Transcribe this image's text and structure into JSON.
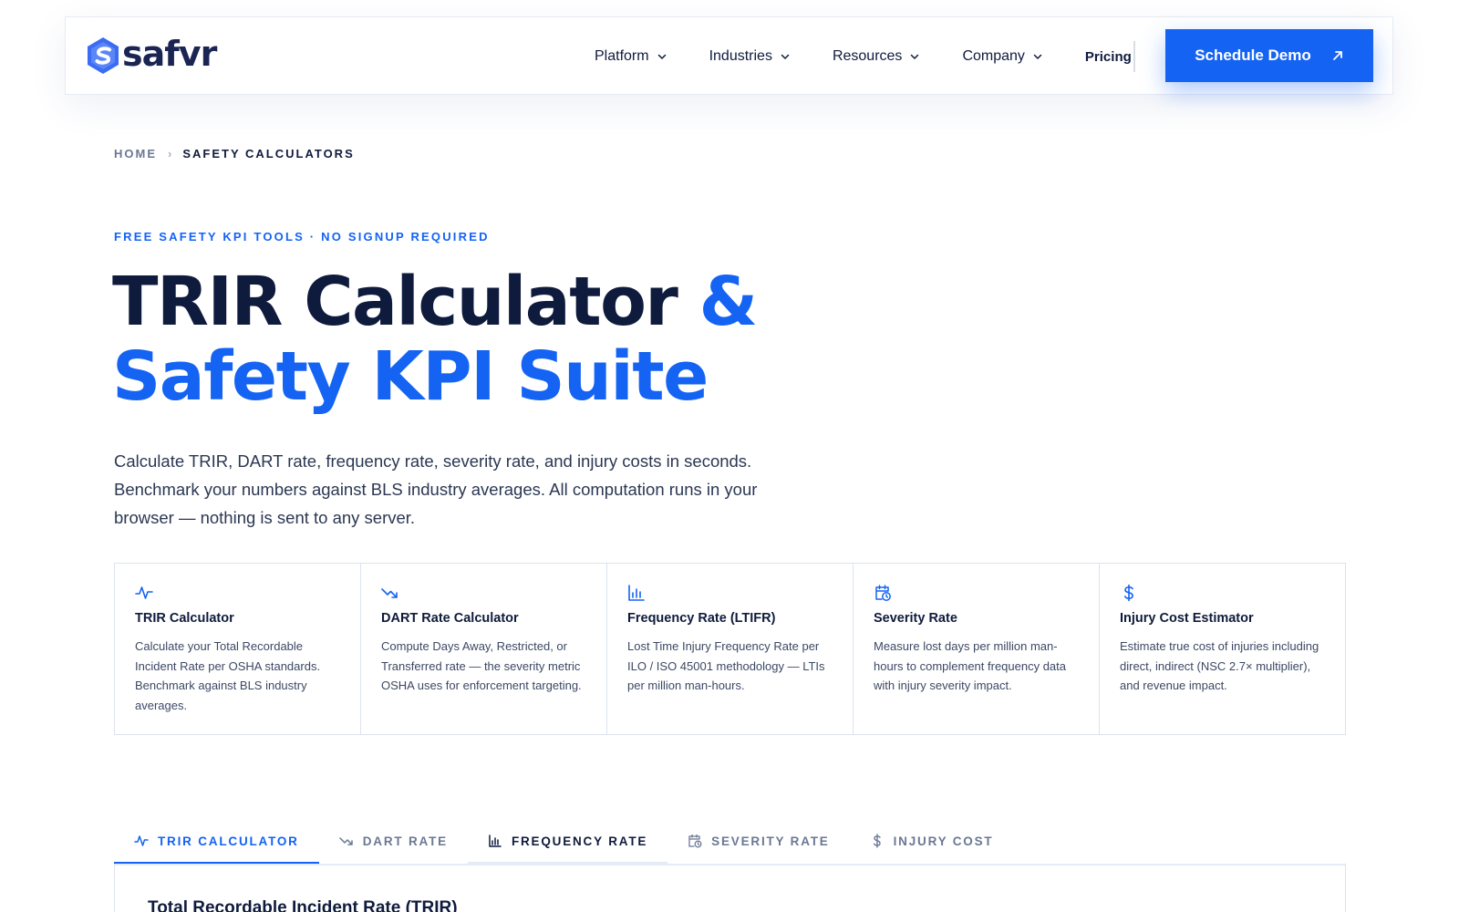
{
  "brand": {
    "name": "safvr",
    "accent": "#1463f3",
    "text": "#0f1b3d"
  },
  "nav": {
    "items": [
      {
        "label": "Platform",
        "icon": "chevron-down-icon"
      },
      {
        "label": "Industries",
        "icon": "chevron-down-icon"
      },
      {
        "label": "Resources",
        "icon": "chevron-down-icon"
      },
      {
        "label": "Company",
        "icon": "chevron-down-icon"
      }
    ],
    "pricing": "Pricing",
    "cta": {
      "label": "Schedule Demo",
      "icon": "arrow-up-right-icon"
    }
  },
  "breadcrumb": {
    "home": "HOME",
    "separator": "›",
    "current": "SAFETY CALCULATORS"
  },
  "hero": {
    "eyebrow": "FREE SAFETY KPI TOOLS · NO SIGNUP REQUIRED",
    "title_part1": "TRIR Calculator ",
    "title_part2": "&",
    "title_line2": "Safety KPI Suite",
    "description": "Calculate TRIR, DART rate, frequency rate, severity rate, and injury costs in seconds. Benchmark your numbers against BLS industry averages. All computation runs in your browser — nothing is sent to any server."
  },
  "cards": [
    {
      "icon": "activity-pulse-icon",
      "title": "TRIR Calculator",
      "description": "Calculate your Total Recordable Incident Rate per OSHA standards. Benchmark against BLS industry averages."
    },
    {
      "icon": "trending-down-icon",
      "title": "DART Rate Calculator",
      "description": "Compute Days Away, Restricted, or Transferred rate — the severity metric OSHA uses for enforcement targeting."
    },
    {
      "icon": "bar-chart-icon",
      "title": "Frequency Rate (LTIFR)",
      "description": "Lost Time Injury Frequency Rate per ILO / ISO 45001 methodology — LTIs per million man-hours."
    },
    {
      "icon": "calendar-clock-icon",
      "title": "Severity Rate",
      "description": "Measure lost days per million man-hours to complement frequency data with injury severity impact."
    },
    {
      "icon": "dollar-icon",
      "title": "Injury Cost Estimator",
      "description": "Estimate true cost of injuries including direct, indirect (NSC 2.7× multiplier), and revenue impact."
    }
  ],
  "tabs": [
    {
      "label": "TRIR CALCULATOR",
      "icon": "activity-pulse-icon",
      "state": "active"
    },
    {
      "label": "DART RATE",
      "icon": "trending-down-icon",
      "state": "default"
    },
    {
      "label": "FREQUENCY RATE",
      "icon": "bar-chart-icon",
      "state": "hover"
    },
    {
      "label": "SEVERITY RATE",
      "icon": "calendar-clock-icon",
      "state": "default"
    },
    {
      "label": "INJURY COST",
      "icon": "dollar-icon",
      "state": "default"
    }
  ],
  "panel": {
    "title": "Total Recordable Incident Rate (TRIR)"
  }
}
